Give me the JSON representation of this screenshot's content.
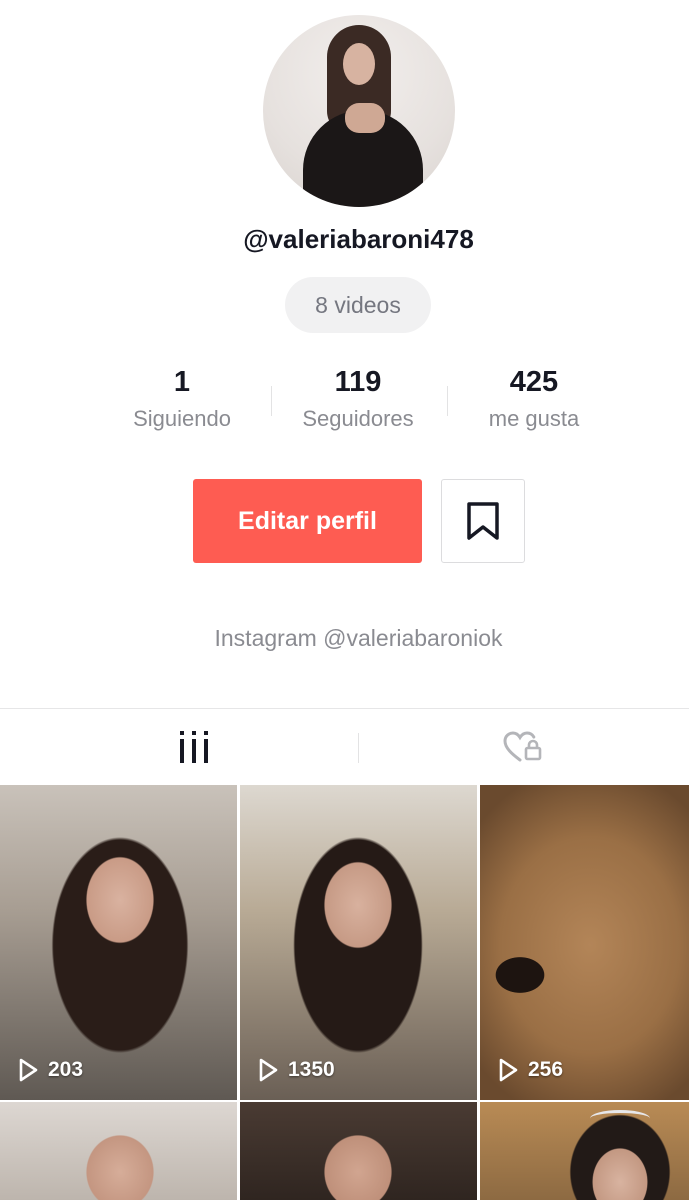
{
  "profile": {
    "username": "@valeriabaroni478",
    "videos_label": "8 videos",
    "bio": "Instagram @valeriabaroniok"
  },
  "stats": [
    {
      "value": "1",
      "label": "Siguiendo"
    },
    {
      "value": "119",
      "label": "Seguidores"
    },
    {
      "value": "425",
      "label": "me gusta"
    }
  ],
  "actions": {
    "edit_label": "Editar perfil"
  },
  "tabs": {
    "videos_icon": "grid-icon",
    "liked_icon": "liked-private-icon"
  },
  "videos": [
    {
      "views": "203"
    },
    {
      "views": "1350"
    },
    {
      "views": "256"
    },
    {
      "views": ""
    },
    {
      "views": ""
    },
    {
      "views": ""
    }
  ],
  "colors": {
    "accent": "#fe5c52",
    "text_primary": "#161823",
    "text_secondary": "#8a8b91"
  }
}
